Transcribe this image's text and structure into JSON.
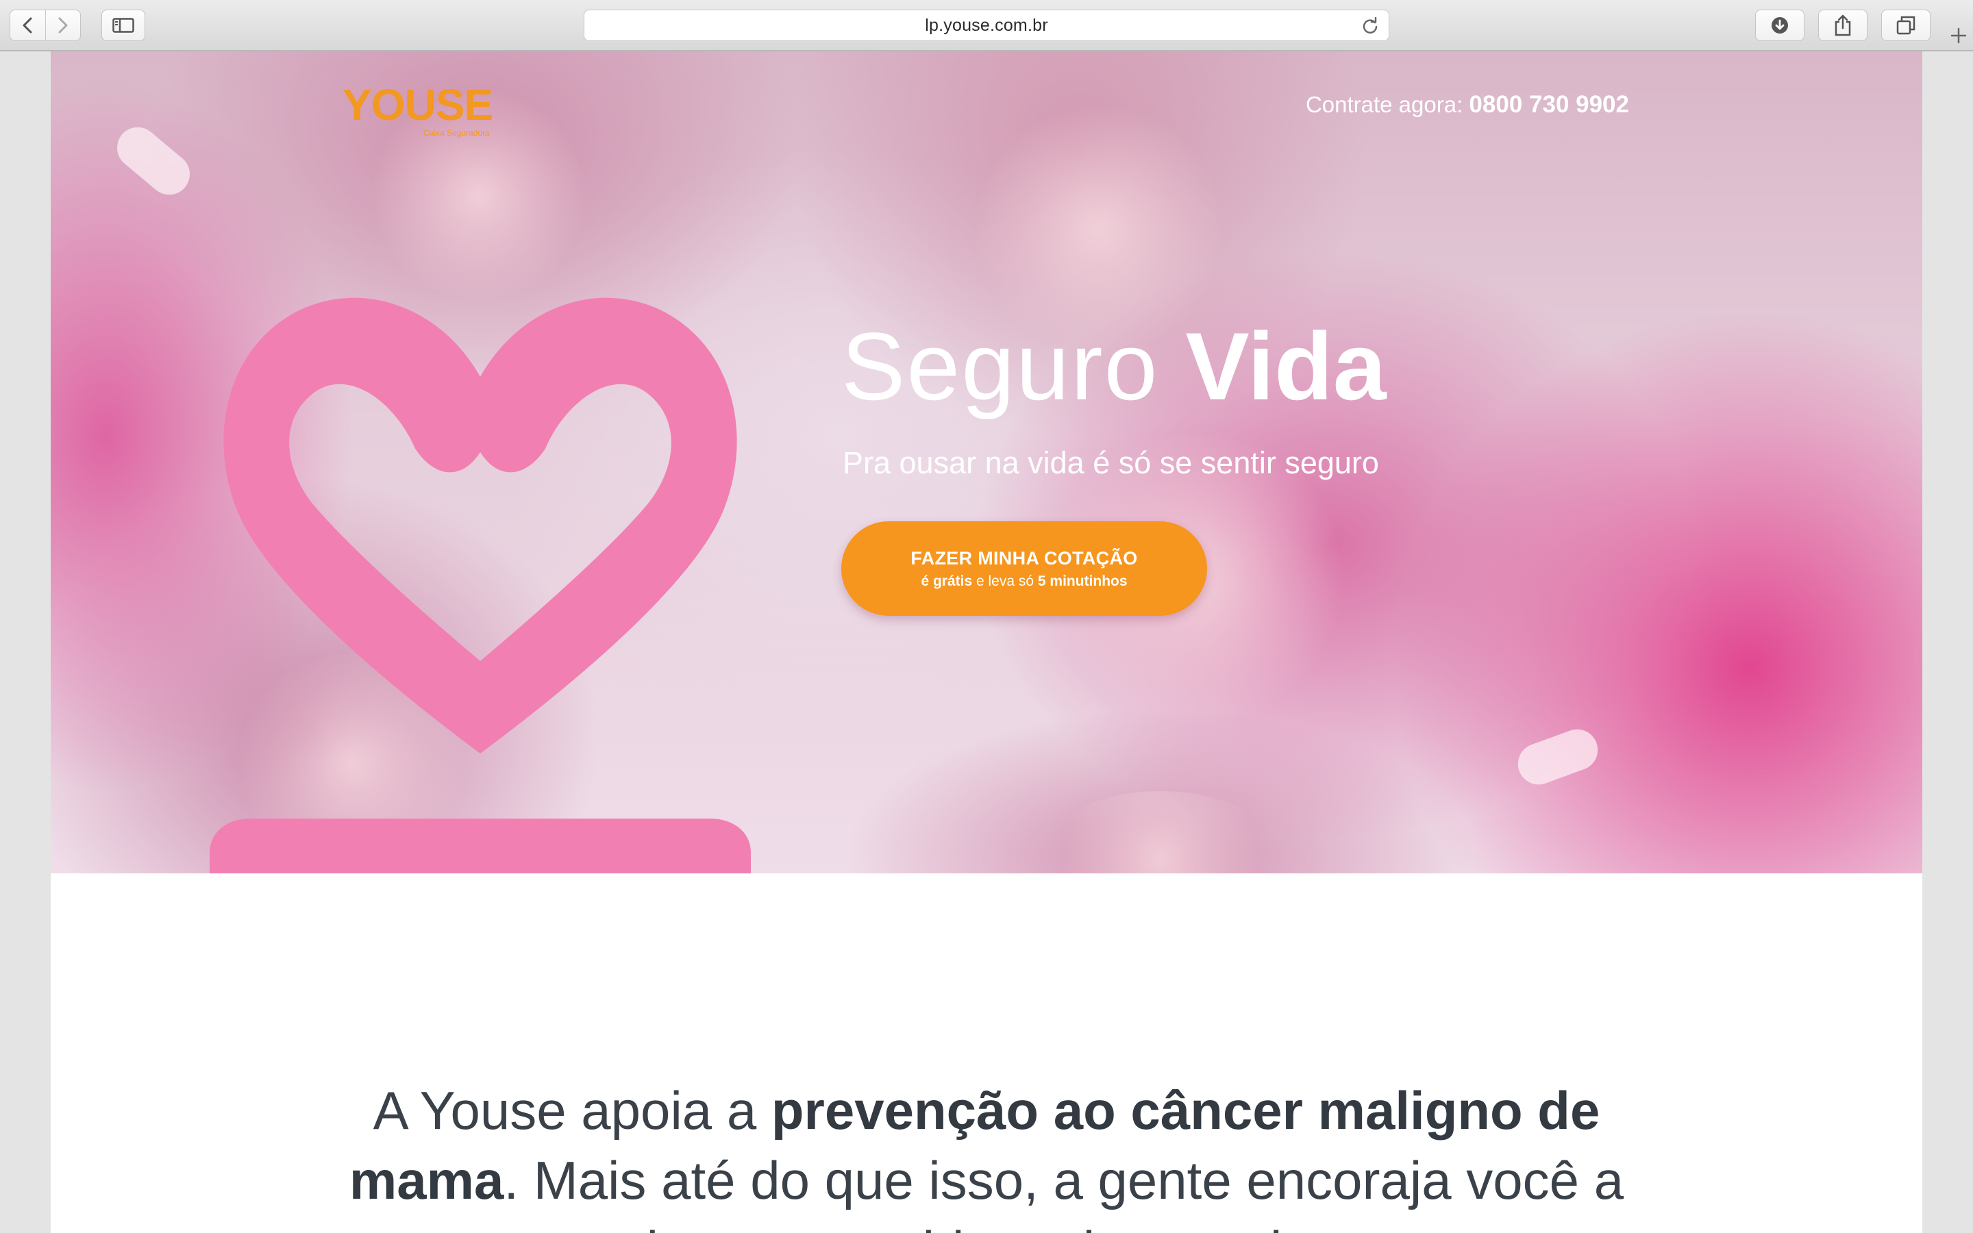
{
  "browser": {
    "url": "lp.youse.com.br"
  },
  "header": {
    "logo_text": "YOUSE",
    "logo_tagline": "Caixa Seguradora",
    "phone_prefix": "Contrate agora:",
    "phone_number": "0800 730 9902"
  },
  "hero": {
    "title_light": "Seguro",
    "title_bold": "Vida",
    "subtitle": "Pra ousar na vida é só se sentir seguro",
    "cta": {
      "label": "FAZER MINHA COTAÇÃO",
      "sub_bold_1": "é grátis",
      "sub_mid": "e leva só",
      "sub_bold_2": "5 minutinhos"
    }
  },
  "statement": {
    "part1": "A Youse apoia a",
    "part2_bold": "prevenção ao câncer maligno de mama",
    "part3": ". Mais até do que isso, a gente encoraja você a levar uma vida mais ousada."
  },
  "colors": {
    "brand_orange": "#f6961e",
    "heart_pink": "#f27fb2",
    "text_dark": "#3a4149"
  },
  "icons": [
    "back-icon",
    "forward-icon",
    "sidebar-icon",
    "reload-icon",
    "download-icon",
    "share-icon",
    "tabs-icon",
    "new-tab-icon",
    "heart-icon"
  ]
}
